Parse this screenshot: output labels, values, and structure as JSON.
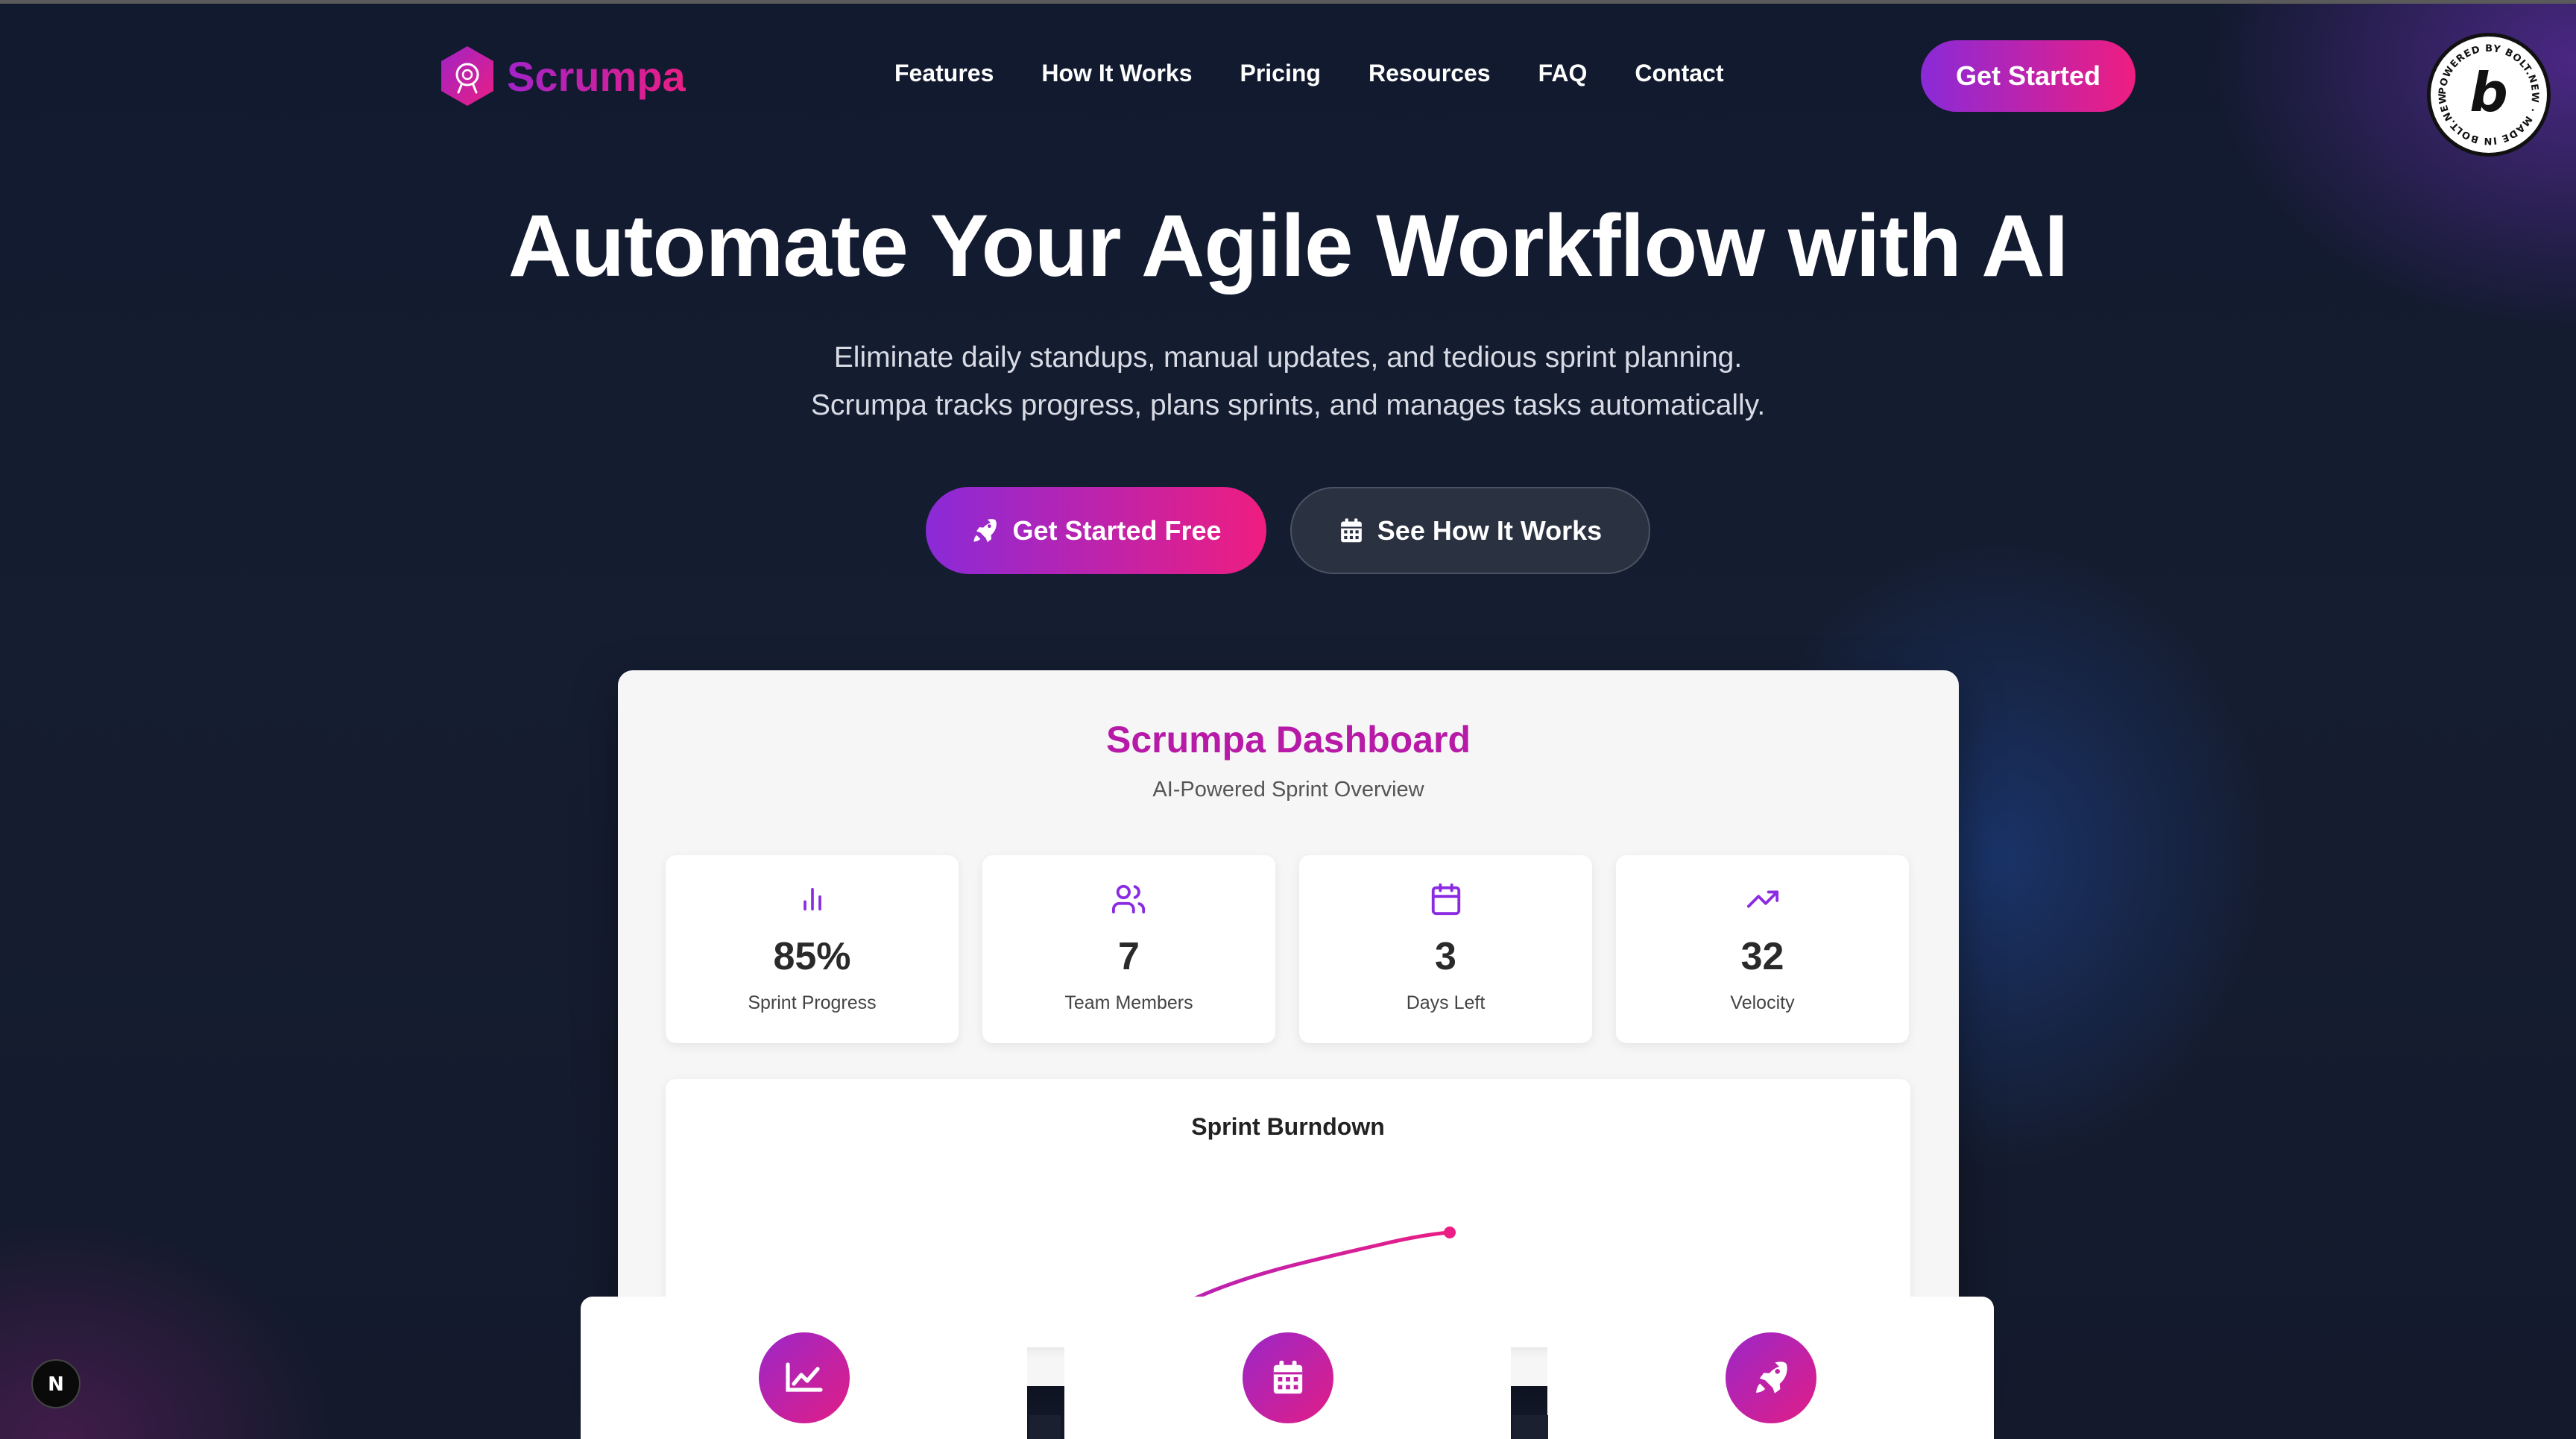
{
  "brand": {
    "name": "Scrumpa"
  },
  "nav": {
    "links": [
      "Features",
      "How It Works",
      "Pricing",
      "Resources",
      "FAQ",
      "Contact"
    ],
    "cta": "Get Started"
  },
  "hero": {
    "title": "Automate Your Agile Workflow with AI",
    "subtitle_line1": "Eliminate daily standups, manual updates, and tedious sprint planning.",
    "subtitle_line2": "Scrumpa tracks progress, plans sprints, and manages tasks automatically.",
    "primary_button": "Get Started Free",
    "primary_icon": "rocket-icon",
    "secondary_button": "See How It Works",
    "secondary_icon": "calendar-icon"
  },
  "dashboard": {
    "title": "Scrumpa Dashboard",
    "subtitle": "AI-Powered Sprint Overview",
    "stats": [
      {
        "icon": "bar-chart-icon",
        "value": "85%",
        "label": "Sprint Progress"
      },
      {
        "icon": "users-icon",
        "value": "7",
        "label": "Team Members"
      },
      {
        "icon": "calendar-icon",
        "value": "3",
        "label": "Days Left"
      },
      {
        "icon": "trending-up-icon",
        "value": "32",
        "label": "Velocity"
      }
    ],
    "burndown_title": "Sprint Burndown"
  },
  "feature_cards": [
    {
      "icon": "chart-line-icon"
    },
    {
      "icon": "calendar-icon"
    },
    {
      "icon": "rocket-icon"
    }
  ],
  "badges": {
    "bolt_letter": "b",
    "bolt_ring_text": "POWERED BY BOLT.NEW · MADE IN BOLT.NEW ·",
    "next_letter": "N"
  },
  "colors": {
    "accent_start": "#8a2ad8",
    "accent_end": "#ef1d80",
    "dashboard_title": "#b61aa6",
    "icon_purple": "#8a2be2"
  }
}
